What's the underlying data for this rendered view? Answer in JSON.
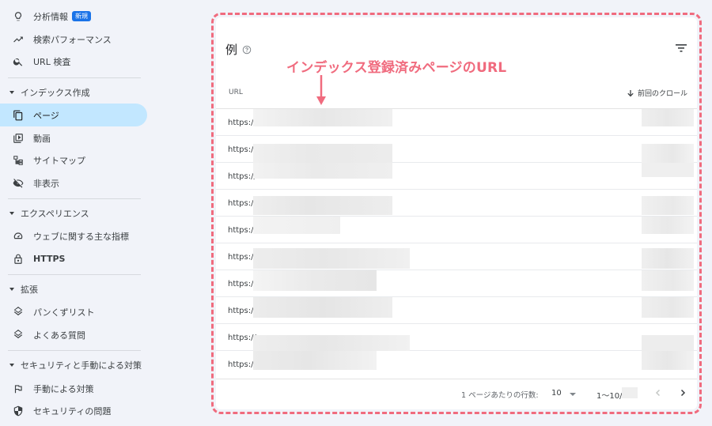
{
  "sidebar": {
    "items": [
      {
        "label": "分析情報",
        "badge": "新規",
        "icon": "lightbulb-icon"
      },
      {
        "label": "検索パフォーマンス",
        "icon": "trending-up-icon"
      },
      {
        "label": "URL 検査",
        "icon": "search-icon"
      }
    ],
    "sections": [
      {
        "title": "インデックス作成",
        "items": [
          {
            "label": "ページ",
            "icon": "pages-icon",
            "active": true
          },
          {
            "label": "動画",
            "icon": "video-icon"
          },
          {
            "label": "サイトマップ",
            "icon": "sitemap-icon"
          },
          {
            "label": "非表示",
            "icon": "eye-off-icon"
          }
        ]
      },
      {
        "title": "エクスペリエンス",
        "items": [
          {
            "label": "ウェブに関する主な指標",
            "icon": "gauge-icon"
          },
          {
            "label": "HTTPS",
            "icon": "lock-icon"
          }
        ]
      },
      {
        "title": "拡張",
        "items": [
          {
            "label": "パンくずリスト",
            "icon": "layers-icon"
          },
          {
            "label": "よくある質問",
            "icon": "layers-icon"
          }
        ]
      },
      {
        "title": "セキュリティと手動による対策",
        "items": [
          {
            "label": "手動による対策",
            "icon": "flag-icon"
          },
          {
            "label": "セキュリティの問題",
            "icon": "shield-icon"
          }
        ]
      }
    ]
  },
  "card": {
    "title": "例",
    "annotation": "インデックス登録済みページのURL",
    "columns": {
      "url": "URL",
      "crawl": "前回のクロール"
    },
    "rows": [
      {
        "url": "https://"
      },
      {
        "url": "https://"
      },
      {
        "url": "https://"
      },
      {
        "url": "https://"
      },
      {
        "url": "https://"
      },
      {
        "url": "https://"
      },
      {
        "url": "https://"
      },
      {
        "url": "https://"
      },
      {
        "url": "https://"
      },
      {
        "url": "https://"
      }
    ],
    "pagination": {
      "rows_per_page_label": "1 ページあたりの行数:",
      "rows_per_page": "10",
      "range": "1〜10/"
    }
  },
  "colors": {
    "accent": "#1a73e8",
    "active_bg": "#c2e7ff",
    "annotation": "#f06b7e"
  }
}
